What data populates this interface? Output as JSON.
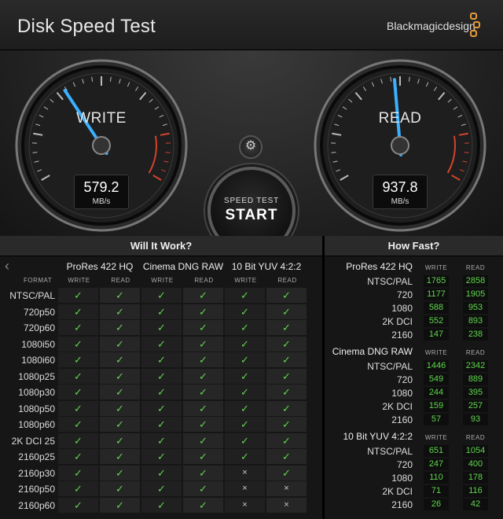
{
  "app_title": "Disk Speed Test",
  "brand": "Blackmagicdesign",
  "colors": {
    "accent_blue": "#3ab0ff",
    "ok_green": "#5fd64d",
    "danger_red": "#d4432c",
    "brand_orange": "#e69a3c"
  },
  "gauges": {
    "write": {
      "label": "WRITE",
      "value": "579.2",
      "unit": "MB/s",
      "needle_fraction": 0.36
    },
    "read": {
      "label": "READ",
      "value": "937.8",
      "unit": "MB/s",
      "needle_fraction": 0.48
    }
  },
  "settings_icon": "gear-icon",
  "start": {
    "small": "SPEED TEST",
    "big": "START"
  },
  "will_it_work": {
    "title": "Will It Work?",
    "back_icon": "chevron-left-icon",
    "format_header": "FORMAT",
    "write_header": "WRITE",
    "read_header": "READ",
    "codecs": [
      "ProRes 422 HQ",
      "Cinema DNG RAW",
      "10 Bit YUV 4:2:2"
    ],
    "rows": [
      {
        "format": "NTSC/PAL",
        "cells": [
          "✓",
          "✓",
          "✓",
          "✓",
          "✓",
          "✓"
        ]
      },
      {
        "format": "720p50",
        "cells": [
          "✓",
          "✓",
          "✓",
          "✓",
          "✓",
          "✓"
        ]
      },
      {
        "format": "720p60",
        "cells": [
          "✓",
          "✓",
          "✓",
          "✓",
          "✓",
          "✓"
        ]
      },
      {
        "format": "1080i50",
        "cells": [
          "✓",
          "✓",
          "✓",
          "✓",
          "✓",
          "✓"
        ]
      },
      {
        "format": "1080i60",
        "cells": [
          "✓",
          "✓",
          "✓",
          "✓",
          "✓",
          "✓"
        ]
      },
      {
        "format": "1080p25",
        "cells": [
          "✓",
          "✓",
          "✓",
          "✓",
          "✓",
          "✓"
        ]
      },
      {
        "format": "1080p30",
        "cells": [
          "✓",
          "✓",
          "✓",
          "✓",
          "✓",
          "✓"
        ]
      },
      {
        "format": "1080p50",
        "cells": [
          "✓",
          "✓",
          "✓",
          "✓",
          "✓",
          "✓"
        ]
      },
      {
        "format": "1080p60",
        "cells": [
          "✓",
          "✓",
          "✓",
          "✓",
          "✓",
          "✓"
        ]
      },
      {
        "format": "2K DCI 25",
        "cells": [
          "✓",
          "✓",
          "✓",
          "✓",
          "✓",
          "✓"
        ]
      },
      {
        "format": "2160p25",
        "cells": [
          "✓",
          "✓",
          "✓",
          "✓",
          "✓",
          "✓"
        ]
      },
      {
        "format": "2160p30",
        "cells": [
          "✓",
          "✓",
          "✓",
          "✓",
          "×",
          "✓"
        ]
      },
      {
        "format": "2160p50",
        "cells": [
          "✓",
          "✓",
          "✓",
          "✓",
          "×",
          "×"
        ]
      },
      {
        "format": "2160p60",
        "cells": [
          "✓",
          "✓",
          "✓",
          "✓",
          "×",
          "×"
        ]
      }
    ]
  },
  "how_fast": {
    "title": "How Fast?",
    "write_header": "WRITE",
    "read_header": "READ",
    "groups": [
      {
        "codec": "ProRes 422 HQ",
        "rows": [
          {
            "format": "NTSC/PAL",
            "write": "1765",
            "read": "2858"
          },
          {
            "format": "720",
            "write": "1177",
            "read": "1905"
          },
          {
            "format": "1080",
            "write": "588",
            "read": "953"
          },
          {
            "format": "2K DCI",
            "write": "552",
            "read": "893"
          },
          {
            "format": "2160",
            "write": "147",
            "read": "238"
          }
        ]
      },
      {
        "codec": "Cinema DNG RAW",
        "rows": [
          {
            "format": "NTSC/PAL",
            "write": "1446",
            "read": "2342"
          },
          {
            "format": "720",
            "write": "549",
            "read": "889"
          },
          {
            "format": "1080",
            "write": "244",
            "read": "395"
          },
          {
            "format": "2K DCI",
            "write": "159",
            "read": "257"
          },
          {
            "format": "2160",
            "write": "57",
            "read": "93"
          }
        ]
      },
      {
        "codec": "10 Bit YUV 4:2:2",
        "rows": [
          {
            "format": "NTSC/PAL",
            "write": "651",
            "read": "1054"
          },
          {
            "format": "720",
            "write": "247",
            "read": "400"
          },
          {
            "format": "1080",
            "write": "110",
            "read": "178"
          },
          {
            "format": "2K DCI",
            "write": "71",
            "read": "116"
          },
          {
            "format": "2160",
            "write": "26",
            "read": "42"
          }
        ]
      }
    ]
  }
}
